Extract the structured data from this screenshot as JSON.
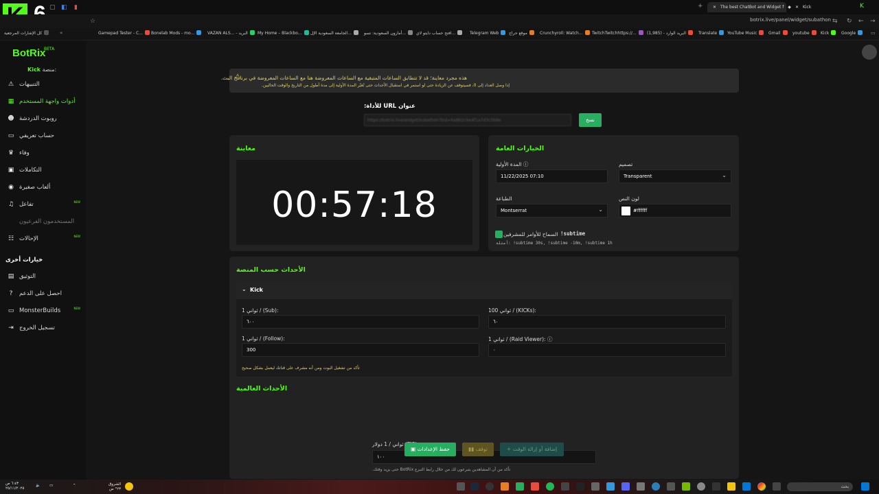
{
  "browser": {
    "tabs": [
      {
        "label": "The best ChatBot and Widget f",
        "active": true
      },
      {
        "label": "Kick",
        "active": false
      }
    ],
    "address": "botrix.live/panel/widget/subathon",
    "overlay_logo": "K",
    "overlay_number": "6",
    "bookmarks": [
      {
        "label": "كل الإشارات المرجعية",
        "color": "#555"
      },
      {
        "label": "Gamepad Tester - C...",
        "color": "#e74c3c"
      },
      {
        "label": "Bonelab Mods - mo...",
        "color": "#3498db"
      },
      {
        "label": "VAZAN ALS... - البريد",
        "color": "#2ecc71"
      },
      {
        "label": "My Home – Blackbo...",
        "color": "#1abc9c"
      },
      {
        "label": "الجامعة السعودية الإل...",
        "color": "#f1c40f"
      },
      {
        "label": "أمازون السعودية: تسو...",
        "color": "#aaa"
      },
      {
        "label": "افتح حساب دايتو لاي...",
        "color": "#888"
      },
      {
        "label": "Telegram Web",
        "color": "#3498db"
      },
      {
        "label": "موقع حراج",
        "color": "#e67e22"
      },
      {
        "label": "Crunchyroll: Watch...",
        "color": "#e67e22"
      },
      {
        "label": "TwitchTwitchhttps://...",
        "color": "#9b59b6"
      },
      {
        "label": "(1,985) - البريد الوارد",
        "color": "#e74c3c"
      },
      {
        "label": "Translate",
        "color": "#3498db"
      },
      {
        "label": "YouTube Music",
        "color": "#e74c3c"
      },
      {
        "label": "Gmail",
        "color": "#e74c3c"
      },
      {
        "label": "youtube",
        "color": "#e74c3c"
      },
      {
        "label": "Kick",
        "color": "#53fc18"
      },
      {
        "label": "Google",
        "color": "#3498db"
      }
    ]
  },
  "app": {
    "logo": "BotRix",
    "beta": "BETA",
    "platform_label": "منصة:",
    "platform_value": "Kick",
    "sidebar": [
      {
        "label": "التنبيهات",
        "icon": "⚠",
        "name": "alerts",
        "active": false,
        "muted": false,
        "badge": ""
      },
      {
        "label": "أدوات واجهة المستخدم",
        "icon": "▦",
        "name": "widgets",
        "active": true,
        "muted": false,
        "badge": ""
      },
      {
        "label": "روبوت الدردشة",
        "icon": "☻",
        "name": "chatbot",
        "active": false,
        "muted": false,
        "badge": ""
      },
      {
        "label": "حساب تعريفي",
        "icon": "▭",
        "name": "profile",
        "active": false,
        "muted": false,
        "badge": ""
      },
      {
        "label": "وفاء",
        "icon": "♛",
        "name": "loyalty",
        "active": false,
        "muted": false,
        "badge": ""
      },
      {
        "label": "التكاملات",
        "icon": "▣",
        "name": "integrations",
        "active": false,
        "muted": false,
        "badge": ""
      },
      {
        "label": "ألعاب صغيرة",
        "icon": "◉",
        "name": "minigames",
        "active": false,
        "muted": false,
        "badge": ""
      },
      {
        "label": "تفاعل",
        "icon": "♫",
        "name": "interaction",
        "active": false,
        "muted": false,
        "badge": "NEW"
      },
      {
        "label": "المستخدمون الفرعيون",
        "icon": "",
        "name": "sub-users",
        "active": false,
        "muted": true,
        "badge": ""
      },
      {
        "label": "الإحالات",
        "icon": "☷",
        "name": "referrals",
        "active": false,
        "muted": false,
        "badge": "NEW"
      }
    ],
    "other_heading": "خيارات أخرى",
    "sidebar_other": [
      {
        "label": "التوثيق",
        "icon": "▤",
        "name": "docs",
        "badge": ""
      },
      {
        "label": "احصل على الدعم",
        "icon": "?",
        "name": "support",
        "badge": ""
      },
      {
        "label": "MonsterBuilds",
        "icon": "▭",
        "name": "monsterbuilds",
        "badge": "NEW"
      },
      {
        "label": "تسجيل الخروج",
        "icon": "⇥",
        "name": "logout",
        "badge": ""
      }
    ]
  },
  "main": {
    "warning_line1": "هذه مجرد معاينة؛ قد لا تتطابق الساعات المتبقية مع الساعات المعروضة هنا مع الساعات المعروضة في برنامج البث.",
    "warning_line2": "إذا وصل العداد إلى 0، فسيتوقف عن الزيادة حتى لو استمر في استقبال الأحداث حتى تُغيّر المدة الأولية إلى مدة أطول من التاريخ والوقت الحاليين.",
    "url_label": "عنوان URL للأداة:",
    "url_value": "https://botrix.live/widget/subathon?bid=6a8b2c9e4f1a7d3c5b8e",
    "copy_button": "نسخ",
    "preview_title": "معاينة",
    "timer": "00:57:18",
    "general_title": "الخيارات العامة",
    "design_label": "تصميم",
    "design_value": "Transparent",
    "initial_duration_label": "المدة الأولية",
    "initial_duration_value": "11/22/2025 07:10",
    "text_color_label": "لون النص",
    "text_color_value": "#ffffff",
    "font_label": "الطباعة",
    "font_value": "Montserrat",
    "command_name": "!subtime",
    "command_label": "السماح للأوامر للمشرفين",
    "command_examples": "أمثلة: !subtime 30s, !subtime -10m, !subtime 1h",
    "platform_events_title": "الأحداث حسب المنصة",
    "kick_label": "Kick",
    "sub_label": "1 ثواني / (Sub):",
    "sub_value": "٦٠٠",
    "kicks_label": "100 ثواني / (KICKs):",
    "kicks_value": "٦٠",
    "follow_label": "1 ثواني / (Follow):",
    "follow_value": "300",
    "raid_label": "1 ثواني / (Raid Viewer):",
    "raid_value": "٠",
    "kick_note": "تأكد من تشغيل البوت ومن أنه مشرف على قناتك ليعمل بشكل صحيح",
    "global_events_title": "الأحداث العالمية",
    "tip_label": "ثواني / 1 دولار (TIP):",
    "tip_value": "١٠٠",
    "tip_note": "تأكد من أن المشاهدين يتبرعون لك من خلال رابط التبرع BotRix حتى يزيد وقتك.",
    "save_button": "حفظ الإعدادات",
    "stop_button": "توقف",
    "add_button": "إضافة أو إزالة الوقت"
  },
  "taskbar": {
    "weather_temp": "٢٣° س",
    "weather_label": "الشروق",
    "search_placeholder": "بحث",
    "time": "٦:٤٣ ص",
    "date": "٢٥/١١/٢٠٢٥"
  }
}
